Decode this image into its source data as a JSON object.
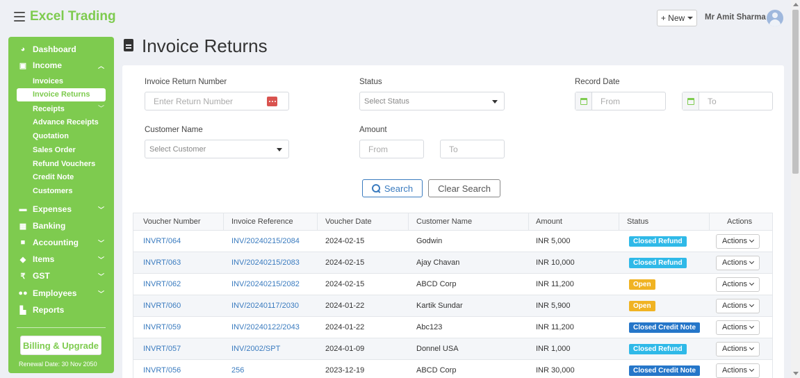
{
  "app": {
    "brand": "Excel Trading",
    "new_button": "+ New",
    "user_name": "Mr Amit Sharma",
    "colors": {
      "brand_green": "#7ecb4f",
      "link_blue": "#3a7bbf",
      "closed_refund": "#2fb9e8",
      "open": "#f0b323",
      "closed_credit_note": "#2576c9"
    }
  },
  "sidebar": {
    "items": [
      {
        "label": "Dashboard",
        "icon": "pie-chart-icon"
      },
      {
        "label": "Income",
        "icon": "money-icon"
      },
      {
        "label": "Expenses",
        "icon": "card-icon"
      },
      {
        "label": "Banking",
        "icon": "bank-icon"
      },
      {
        "label": "Accounting",
        "icon": "book-icon"
      },
      {
        "label": "Items",
        "icon": "tag-icon"
      },
      {
        "label": "GST",
        "icon": "rupee-icon"
      },
      {
        "label": "Employees",
        "icon": "users-icon"
      },
      {
        "label": "Reports",
        "icon": "bar-chart-icon"
      }
    ],
    "income_sub": [
      "Invoices",
      "Invoice Returns",
      "Receipts",
      "Advance Receipts",
      "Quotation",
      "Sales Order",
      "Refund Vouchers",
      "Credit Note",
      "Customers"
    ],
    "billing_button": "Billing & Upgrade",
    "renewal": "Renewal Date: 30 Nov 2050"
  },
  "page": {
    "title": "Invoice Returns"
  },
  "filters": {
    "return_number_label": "Invoice Return Number",
    "return_number_placeholder": "Enter Return Number",
    "status_label": "Status",
    "status_value": "Select Status",
    "record_date_label": "Record Date",
    "date_from": "From",
    "date_to": "To",
    "customer_label": "Customer Name",
    "customer_value": "Select Customer",
    "amount_label": "Amount",
    "amount_from": "From",
    "amount_to": "To",
    "search_button": "Search",
    "clear_button": "Clear Search"
  },
  "table": {
    "headers": [
      "Voucher Number",
      "Invoice Reference",
      "Voucher Date",
      "Customer Name",
      "Amount",
      "Status",
      "Actions"
    ],
    "rows": [
      {
        "voucher": "INVRT/064",
        "invoice": "INV/20240215/2084",
        "date": "2024-02-15",
        "customer": "Godwin",
        "amount": "INR 5,000",
        "status": "Closed Refund",
        "action": "Actions"
      },
      {
        "voucher": "INVRT/063",
        "invoice": "INV/20240215/2083",
        "date": "2024-02-15",
        "customer": "Ajay Chavan",
        "amount": "INR 10,000",
        "status": "Closed Refund",
        "action": "Actions"
      },
      {
        "voucher": "INVRT/062",
        "invoice": "INV/20240215/2082",
        "date": "2024-02-15",
        "customer": "ABCD Corp",
        "amount": "INR 11,200",
        "status": "Open",
        "action": "Actions"
      },
      {
        "voucher": "INVRT/060",
        "invoice": "INV/20240117/2030",
        "date": "2024-01-22",
        "customer": "Kartik Sundar",
        "amount": "INR 5,900",
        "status": "Open",
        "action": "Actions"
      },
      {
        "voucher": "INVRT/059",
        "invoice": "INV/20240122/2043",
        "date": "2024-01-22",
        "customer": "Abc123",
        "amount": "INR 11,200",
        "status": "Closed Credit Note",
        "action": "Actions"
      },
      {
        "voucher": "INVRT/057",
        "invoice": "INV/2002/SPT",
        "date": "2024-01-09",
        "customer": "Donnel USA",
        "amount": "INR 1,000",
        "status": "Closed Refund",
        "action": "Actions"
      },
      {
        "voucher": "INVRT/056",
        "invoice": "256",
        "date": "2023-12-19",
        "customer": "ABCD Corp",
        "amount": "INR 30,000",
        "status": "Closed Credit Note",
        "action": "Actions"
      }
    ]
  }
}
